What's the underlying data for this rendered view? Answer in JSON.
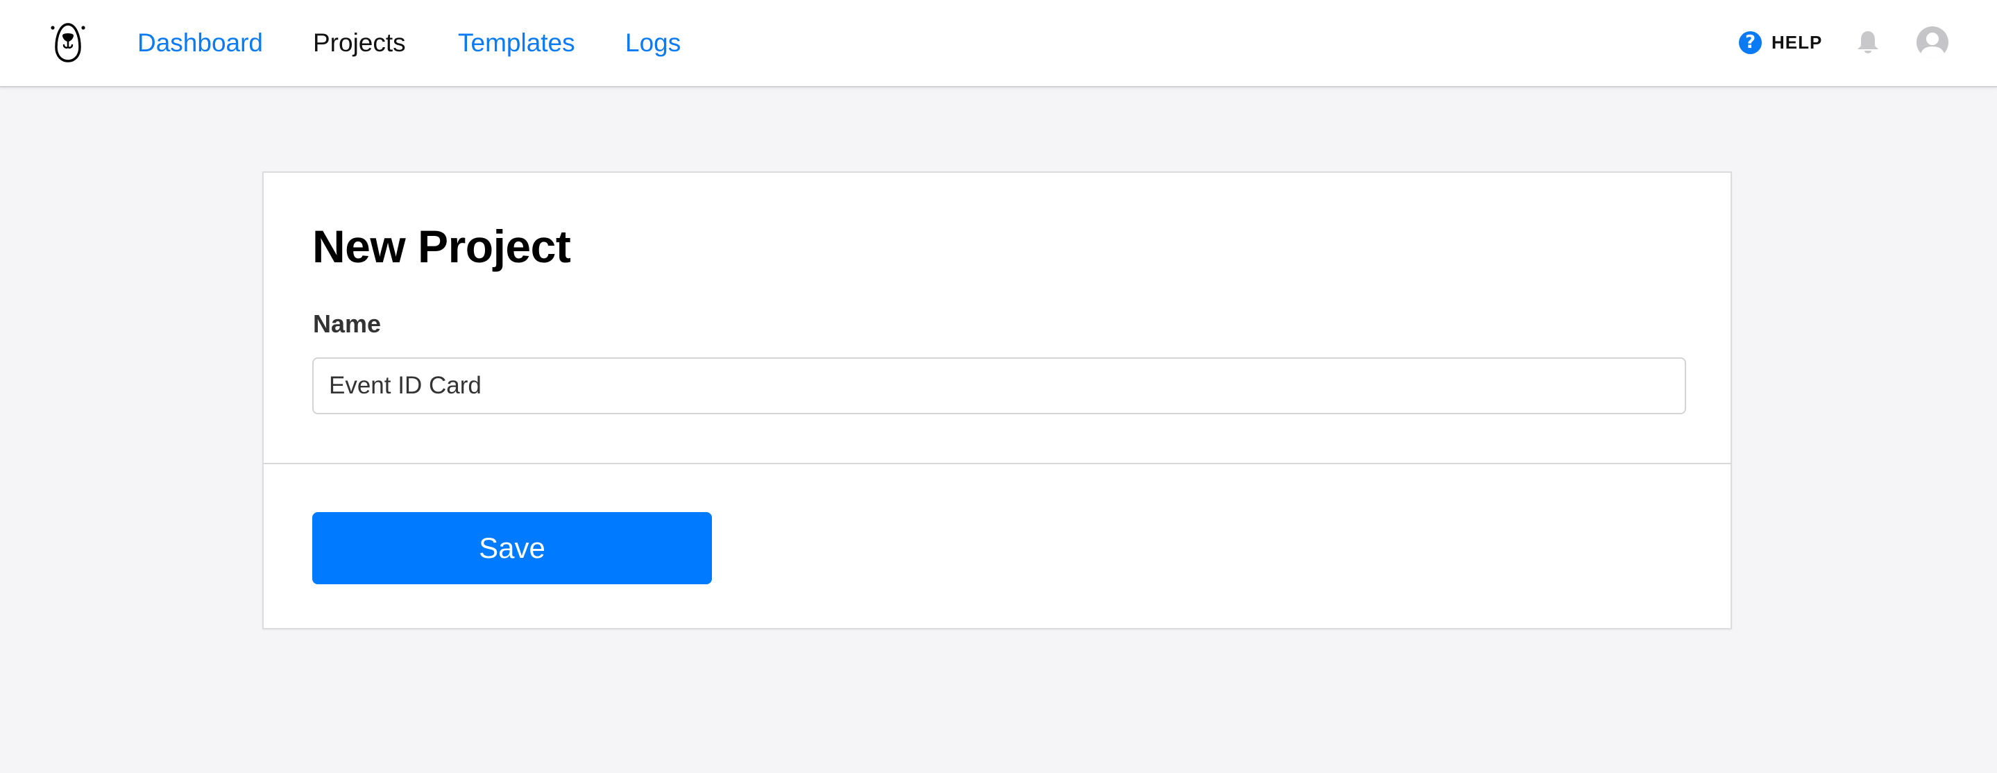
{
  "header": {
    "logo": "bear-logo-icon",
    "nav": [
      {
        "label": "Dashboard",
        "active": false
      },
      {
        "label": "Projects",
        "active": true
      },
      {
        "label": "Templates",
        "active": false
      },
      {
        "label": "Logs",
        "active": false
      }
    ],
    "help": {
      "icon": "question-circle-icon",
      "label": "HELP"
    },
    "notifications_icon": "bell-icon",
    "avatar_icon": "user-avatar-icon"
  },
  "form": {
    "title": "New Project",
    "name_label": "Name",
    "name_value": "Event ID Card",
    "save_label": "Save"
  },
  "colors": {
    "accent": "#007bff",
    "link": "#0a7bf5",
    "background": "#f5f5f7",
    "muted_icon": "#c8c8ca"
  }
}
